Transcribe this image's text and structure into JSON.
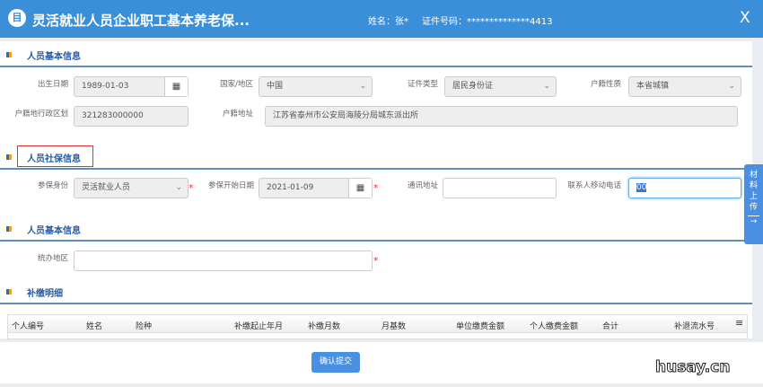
{
  "header": {
    "title": "灵活就业人员企业职工基本养老保...",
    "name_label": "姓名：",
    "name_value": "张*",
    "id_label": "证件号码：",
    "id_value": "**************4413",
    "close": "X",
    "logo": "目"
  },
  "section1": {
    "title": "人员基本信息",
    "fields": [
      {
        "label": "出生日期",
        "value": "1989-01-03"
      },
      {
        "label": "国家/地区",
        "value": "中国"
      },
      {
        "label": "证件类型",
        "value": "居民身份证"
      },
      {
        "label": "户籍性质",
        "value": "本省城镇"
      },
      {
        "label": "户籍地行政区划",
        "value": "321283000000"
      },
      {
        "label": "户籍地址",
        "value": "江苏省泰州市公安局海陵分局城东派出所"
      }
    ]
  },
  "section2": {
    "title": "人员社保信息",
    "fields": [
      {
        "label": "参保身份",
        "value": "灵活就业人员"
      },
      {
        "label": "参保开始日期",
        "value": "2021-01-09"
      },
      {
        "label": "通讯地址",
        "value": ""
      },
      {
        "label": "联系人移动电话",
        "value": "00"
      }
    ]
  },
  "section3": {
    "title": "人员基本信息",
    "fields": [
      {
        "label": "统办地区",
        "value": ""
      }
    ]
  },
  "section4": {
    "title": "补缴明细",
    "columns": [
      "个人编号",
      "姓名",
      "险种",
      "补缴起止年月",
      "补缴月数",
      "月基数",
      "单位缴费金额",
      "个人缴费金额",
      "合计",
      "补退流水号"
    ],
    "menu": "≡"
  },
  "side_tab": {
    "chars": [
      "材",
      "料",
      "上",
      "传"
    ],
    "arrow": "→"
  },
  "footer": {
    "submit": "确认提交",
    "watermark": "husay.cn"
  },
  "required_mark": "*",
  "colors": {
    "header": "#3b8fd8",
    "accent": "#4a90e2",
    "highlight_box": "#e03030"
  }
}
